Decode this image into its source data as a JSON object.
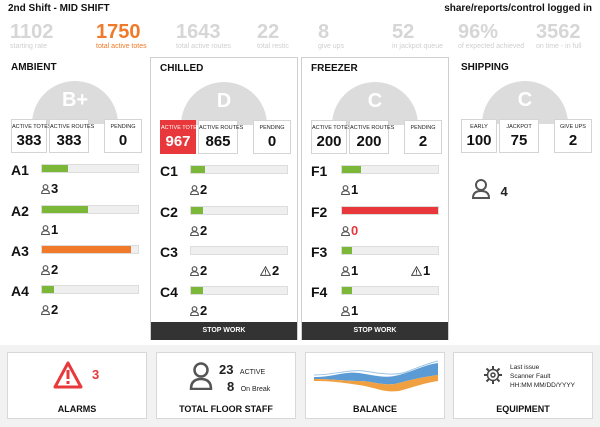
{
  "header": {
    "shift": "2nd Shift - MID SHIFT",
    "links": "share/reports/control logged in"
  },
  "stats": [
    {
      "value": "1102",
      "label": "starting rate"
    },
    {
      "value": "1750",
      "label": "total active totes"
    },
    {
      "value": "1643",
      "label": "total active routes"
    },
    {
      "value": "22",
      "label": "total restic"
    },
    {
      "value": "8",
      "label": "give ups"
    },
    {
      "value": "52",
      "label": "in jackpot queue"
    },
    {
      "value": "96%",
      "label": "of expected achieved"
    },
    {
      "value": "3562",
      "label": "on time - in full"
    }
  ],
  "panels": {
    "ambient": {
      "title": "AMBIENT",
      "grade": "B+",
      "boxes": [
        {
          "label": "ACTIVE TOTES",
          "value": "383"
        },
        {
          "label": "ACTIVE ROUTES",
          "value": "383"
        },
        {
          "label": "PENDING",
          "value": "0"
        }
      ],
      "rows": [
        {
          "label": "A1",
          "fill": 0.27,
          "color": "#7bb83a",
          "people": "3",
          "warn": ""
        },
        {
          "label": "A2",
          "fill": 0.48,
          "color": "#7bb83a",
          "people": "1",
          "warn": ""
        },
        {
          "label": "A3",
          "fill": 0.93,
          "color": "#f07a2a",
          "people": "2",
          "warn": ""
        },
        {
          "label": "A4",
          "fill": 0.12,
          "color": "#7bb83a",
          "people": "2",
          "warn": ""
        }
      ]
    },
    "chilled": {
      "title": "CHILLED",
      "grade": "D",
      "boxes": [
        {
          "label": "ACTIVE TOTES",
          "value": "967"
        },
        {
          "label": "ACTIVE ROUTES",
          "value": "865"
        },
        {
          "label": "PENDING",
          "value": "0"
        }
      ],
      "rows": [
        {
          "label": "C1",
          "fill": 0.15,
          "color": "#7bb83a",
          "people": "2",
          "warn": ""
        },
        {
          "label": "C2",
          "fill": 0.12,
          "color": "#7bb83a",
          "people": "2",
          "warn": ""
        },
        {
          "label": "C3",
          "fill": 0.0,
          "color": "#7bb83a",
          "people": "2",
          "warn": "2"
        },
        {
          "label": "C4",
          "fill": 0.12,
          "color": "#7bb83a",
          "people": "2",
          "warn": ""
        }
      ],
      "stop": "STOP WORK"
    },
    "freezer": {
      "title": "FREEZER",
      "grade": "C",
      "boxes": [
        {
          "label": "ACTIVE TOTES",
          "value": "200"
        },
        {
          "label": "ACTIVE ROUTES",
          "value": "200"
        },
        {
          "label": "PENDING",
          "value": "2"
        }
      ],
      "rows": [
        {
          "label": "F1",
          "fill": 0.2,
          "color": "#7bb83a",
          "people": "1",
          "warn": ""
        },
        {
          "label": "F2",
          "fill": 1.0,
          "color": "#e8383b",
          "people": "0",
          "warn": ""
        },
        {
          "label": "F3",
          "fill": 0.1,
          "color": "#7bb83a",
          "people": "1",
          "warn": "1"
        },
        {
          "label": "F4",
          "fill": 0.1,
          "color": "#7bb83a",
          "people": "1",
          "warn": ""
        }
      ],
      "stop": "STOP WORK"
    },
    "shipping": {
      "title": "SHIPPING",
      "grade": "C",
      "boxes": [
        {
          "label": "EARLY",
          "value": "100"
        },
        {
          "label": "JACKPOT",
          "value": "75"
        },
        {
          "label": "GIVE UPS",
          "value": "2"
        }
      ],
      "people": "4"
    }
  },
  "bottom": {
    "alarms": {
      "title": "ALARMS",
      "count": "3"
    },
    "staff": {
      "title": "TOTAL FLOOR STAFF",
      "active": "23",
      "active_label": "ACTIVE",
      "break": "8",
      "break_label": "On Break"
    },
    "balance": {
      "title": "BALANCE"
    },
    "equipment": {
      "title": "EQUIPMENT",
      "line1": "Last issue",
      "line2": "Scanner Fault",
      "line3": "HH:MM  MM/DD/YYYY"
    }
  },
  "colors": {
    "accent": "#f07a2a",
    "alert": "#e8383b",
    "ok": "#7bb83a"
  }
}
